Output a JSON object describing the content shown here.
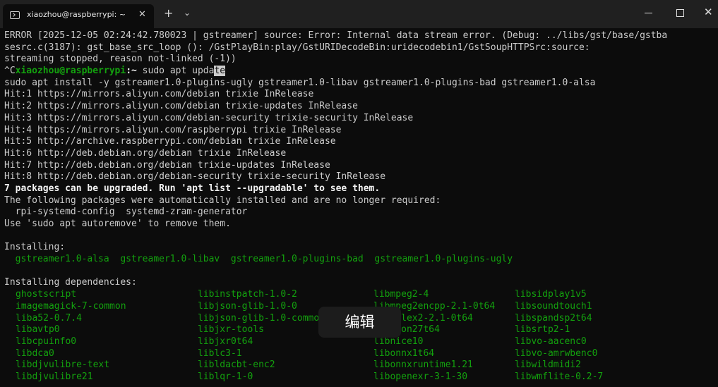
{
  "window": {
    "tab_title": "xiaozhou@raspberrypi: ~",
    "tab_close": "✕",
    "new_tab": "+",
    "dropdown": "⌄",
    "close_glyph": "✕"
  },
  "terminal": {
    "lines": [
      "ERROR [2025-12-05 02:24:42.780023 | gstreamer] source: Error: Internal data stream error. (Debug: ../libs/gst/base/gstba",
      "sesrc.c(3187): gst_base_src_loop (): /GstPlayBin:play/GstURIDecodeBin:uridecodebin1/GstSoupHTTPSrc:source:",
      "streaming stopped, reason not-linked (-1))"
    ],
    "prompt_prefix": "^C",
    "prompt_user": "xiaozhou@raspberrypi",
    "prompt_sep": ":~",
    "prompt_symbol": " $",
    "command_main": " sudo apt upda",
    "command_cursor": "te",
    "lines2": [
      "sudo apt install -y gstreamer1.0-plugins-ugly gstreamer1.0-libav gstreamer1.0-plugins-bad gstreamer1.0-alsa",
      "Hit:1 https://mirrors.aliyun.com/debian trixie InRelease",
      "Hit:2 https://mirrors.aliyun.com/debian trixie-updates InRelease",
      "Hit:3 https://mirrors.aliyun.com/debian-security trixie-security InRelease",
      "Hit:4 https://mirrors.aliyun.com/raspberrypi trixie InRelease",
      "Hit:5 http://archive.raspberrypi.com/debian trixie InRelease",
      "Hit:6 http://deb.debian.org/debian trixie InRelease",
      "Hit:7 http://deb.debian.org/debian trixie-updates InRelease",
      "Hit:8 http://deb.debian.org/debian-security trixie-security InRelease"
    ],
    "upgrade_notice": "7 packages can be upgraded. Run 'apt list --upgradable' to see them.",
    "auto_installed_header": "The following packages were automatically installed and are no longer required:",
    "auto_installed_packages": "  rpi-systemd-config  systemd-zram-generator",
    "autoremove_hint": "Use 'sudo apt autoremove' to remove them.",
    "installing_header": "Installing:",
    "installing_packages": "  gstreamer1.0-alsa  gstreamer1.0-libav  gstreamer1.0-plugins-bad  gstreamer1.0-plugins-ugly",
    "dependencies_header": "Installing dependencies:",
    "dependencies": [
      [
        "ghostscript",
        "libinstpatch-1.0-2",
        "libmpeg2-4",
        "libsidplay1v5"
      ],
      [
        "imagemagick-7-common",
        "libjson-glib-1.0-0",
        "libmpeg2encpp-2.1-0t64",
        "libsoundtouch1"
      ],
      [
        "liba52-0.7.4",
        "libjson-glib-1.0-common",
        "libmplex2-2.1-0t64",
        "libspandsp2t64"
      ],
      [
        "libavtp0",
        "libjxr-tools",
        "libneon27t64",
        "libsrtp2-1"
      ],
      [
        "libcpuinfo0",
        "libjxr0t64",
        "libnice10",
        "libvo-aacenc0"
      ],
      [
        "libdca0",
        "liblc3-1",
        "libonnx1t64",
        "libvo-amrwbenc0"
      ],
      [
        "libdjvulibre-text",
        "libldacbt-enc2",
        "libonnxruntime1.21",
        "libwildmidi2"
      ],
      [
        "libdjvulibre21",
        "liblqr-1-0",
        "libopenexr-3-1-30",
        "libwmflite-0.2-7"
      ]
    ]
  },
  "overlay": {
    "label": "编辑"
  },
  "colors": {
    "background": "#0c0c0c",
    "foreground": "#cccccc",
    "green": "#13a10e",
    "titlebar": "#202020"
  }
}
